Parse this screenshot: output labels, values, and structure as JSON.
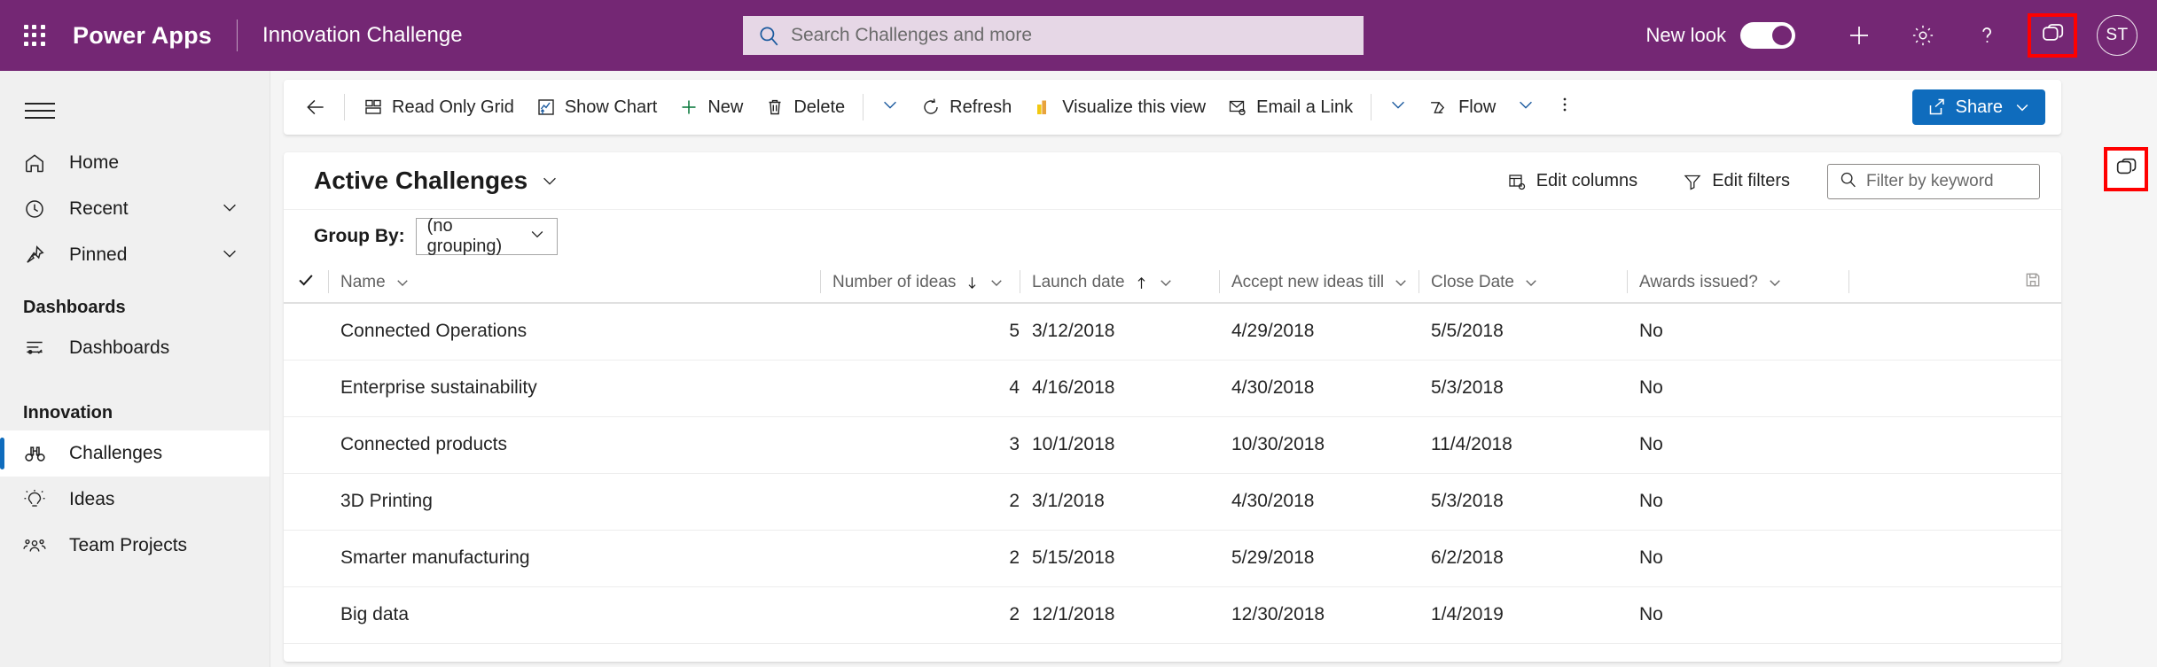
{
  "header": {
    "brand": "Power Apps",
    "app_name": "Innovation Challenge",
    "waffle_icon": "app-launcher-icon",
    "search": {
      "placeholder": "Search Challenges and more",
      "value": "",
      "icon": "search-icon"
    },
    "new_look_label": "New look",
    "new_look_on": true,
    "actions": [
      {
        "name": "new-button",
        "icon": "plus-icon"
      },
      {
        "name": "settings-button",
        "icon": "gear-icon"
      },
      {
        "name": "help-button",
        "icon": "question-mark-icon"
      },
      {
        "name": "copilot-button",
        "icon": "copilot-icon",
        "highlighted": true
      }
    ],
    "avatar_initials": "ST",
    "accent_color": "#742774"
  },
  "sidebar": {
    "hamburger_icon": "hamburger-menu-icon",
    "items": [
      {
        "label": "Home",
        "icon": "home-icon",
        "has_chevron": false,
        "selected": false
      },
      {
        "label": "Recent",
        "icon": "clock-icon",
        "has_chevron": true,
        "selected": false
      },
      {
        "label": "Pinned",
        "icon": "pin-icon",
        "has_chevron": true,
        "selected": false
      }
    ],
    "groups": [
      {
        "title": "Dashboards",
        "items": [
          {
            "label": "Dashboards",
            "icon": "dashboard-icon",
            "selected": false
          }
        ]
      },
      {
        "title": "Innovation",
        "items": [
          {
            "label": "Challenges",
            "icon": "binoculars-icon",
            "selected": true
          },
          {
            "label": "Ideas",
            "icon": "lightbulb-icon",
            "selected": false
          },
          {
            "label": "Team Projects",
            "icon": "people-icon",
            "selected": false
          }
        ]
      }
    ],
    "selected_indicator_color": "#0f6cbd"
  },
  "command_bar": {
    "back_icon": "arrow-left-icon",
    "commands": [
      {
        "label": "Read Only Grid",
        "icon": "grid-icon"
      },
      {
        "label": "Show Chart",
        "icon": "chart-icon"
      },
      {
        "label": "New",
        "icon": "plus-icon"
      },
      {
        "label": "Delete",
        "icon": "trash-icon"
      },
      {
        "label": "",
        "icon": "chevron-down-icon"
      },
      {
        "label": "Refresh",
        "icon": "refresh-icon"
      },
      {
        "label": "Visualize this view",
        "icon": "powerbi-icon"
      },
      {
        "label": "Email a Link",
        "icon": "email-icon"
      },
      {
        "label": "",
        "icon": "chevron-down-icon"
      },
      {
        "label": "Flow",
        "icon": "flow-icon"
      },
      {
        "label": "",
        "icon": "chevron-down-icon"
      },
      {
        "label": "",
        "icon": "more-vertical-icon"
      }
    ],
    "share": {
      "label": "Share",
      "icon": "share-icon",
      "chevron": "chevron-down-icon",
      "color": "#0f6cbd"
    },
    "side_copilot_icon": "copilot-icon"
  },
  "view": {
    "title": "Active Challenges",
    "title_chevron": "chevron-down-icon",
    "edit_columns": {
      "label": "Edit columns",
      "icon": "edit-columns-icon"
    },
    "edit_filters": {
      "label": "Edit filters",
      "icon": "filter-icon"
    },
    "keyword_filter": {
      "placeholder": "Filter by keyword",
      "value": "",
      "icon": "search-icon"
    },
    "group_by_label": "Group By:",
    "group_by_value": "(no grouping)",
    "group_by_chevron": "chevron-down-icon"
  },
  "table": {
    "select_all_icon": "checkmark-icon",
    "save_icon": "save-icon",
    "columns": [
      {
        "label": "Name",
        "sort": "",
        "align": "left"
      },
      {
        "label": "Number of ideas",
        "sort": "desc",
        "align": "right"
      },
      {
        "label": "Launch date",
        "sort": "asc",
        "align": "left"
      },
      {
        "label": "Accept new ideas till",
        "sort": "",
        "align": "left"
      },
      {
        "label": "Close Date",
        "sort": "",
        "align": "left"
      },
      {
        "label": "Awards issued?",
        "sort": "",
        "align": "left"
      }
    ],
    "rows": [
      {
        "name": "Connected Operations",
        "ideas": "5",
        "launch": "3/12/2018",
        "accept": "4/29/2018",
        "close": "5/5/2018",
        "awards": "No"
      },
      {
        "name": "Enterprise sustainability",
        "ideas": "4",
        "launch": "4/16/2018",
        "accept": "4/30/2018",
        "close": "5/3/2018",
        "awards": "No"
      },
      {
        "name": "Connected products",
        "ideas": "3",
        "launch": "10/1/2018",
        "accept": "10/30/2018",
        "close": "11/4/2018",
        "awards": "No"
      },
      {
        "name": "3D Printing",
        "ideas": "2",
        "launch": "3/1/2018",
        "accept": "4/30/2018",
        "close": "5/3/2018",
        "awards": "No"
      },
      {
        "name": "Smarter manufacturing",
        "ideas": "2",
        "launch": "5/15/2018",
        "accept": "5/29/2018",
        "close": "6/2/2018",
        "awards": "No"
      },
      {
        "name": "Big data",
        "ideas": "2",
        "launch": "12/1/2018",
        "accept": "12/30/2018",
        "close": "1/4/2019",
        "awards": "No"
      }
    ]
  }
}
